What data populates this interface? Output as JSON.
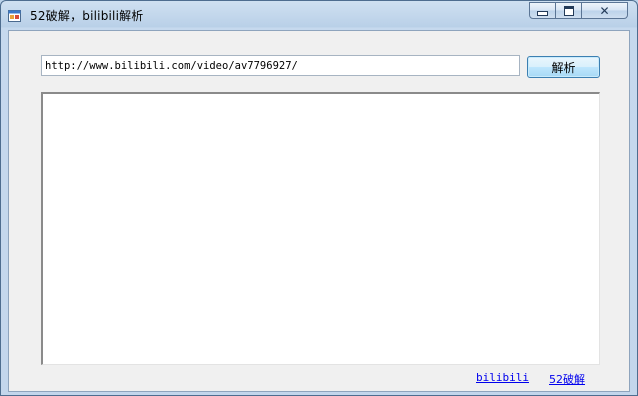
{
  "window": {
    "title": "52破解，bilibili解析",
    "icon": "app-window-icon",
    "controls": {
      "minimize": "minimize-icon",
      "maximize": "maximize-icon",
      "close": "close-icon",
      "close_glyph": "✕"
    }
  },
  "form": {
    "url_value": "http://www.bilibili.com/video/av7796927/",
    "parse_button_label": "解析",
    "output_text": ""
  },
  "links": {
    "bilibili": "bilibili",
    "pojie": "52破解"
  },
  "colors": {
    "link": "#0000ee",
    "client_bg": "#f0f0f0",
    "button_border": "#3c7fb1"
  }
}
